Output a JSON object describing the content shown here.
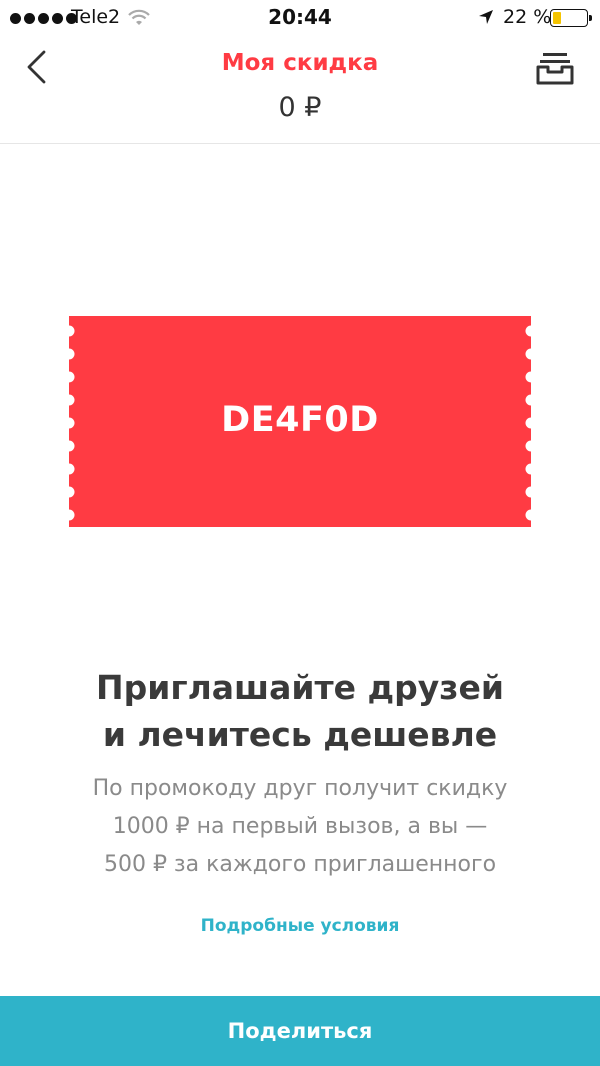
{
  "status_bar": {
    "carrier": "Tele2",
    "time": "20:44",
    "battery_percent": "22 %",
    "battery_level": 0.22
  },
  "header": {
    "title": "Моя скидка",
    "amount": "0 ₽",
    "back_icon": "chevron-left-icon",
    "history_icon": "inbox-tray-icon"
  },
  "ticket": {
    "promo_code": "DE4F0D"
  },
  "content": {
    "heading_line1": "Приглашайте друзей",
    "heading_line2": "и лечитесь дешевле",
    "desc_line1": "По промокоду друг получит скидку",
    "desc_line2": "1000 ₽ на первый вызов, а вы —",
    "desc_line3": "500 ₽ за каждого приглашенного",
    "terms_link": "Подробные условия"
  },
  "footer": {
    "share_label": "Поделиться"
  },
  "colors": {
    "accent_red": "#ff3b43",
    "accent_teal": "#2fb3c9",
    "text_dark": "#3a3a3a",
    "text_muted": "#8a8a8a"
  }
}
